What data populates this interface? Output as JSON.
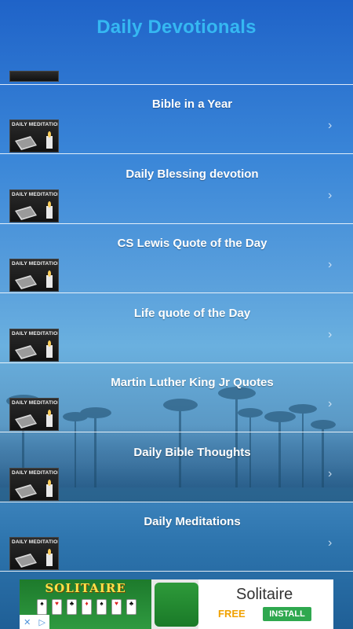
{
  "header": {
    "title": "Daily Devotionals"
  },
  "thumbnail_caption": "DAILY MEDITATION",
  "list": {
    "items": [
      {
        "label": "Bible in a Year"
      },
      {
        "label": "Daily Blessing devotion"
      },
      {
        "label": "CS Lewis Quote of the Day"
      },
      {
        "label": "Life quote of the Day"
      },
      {
        "label": "Martin Luther King Jr Quotes"
      },
      {
        "label": "Daily Bible Thoughts"
      },
      {
        "label": "Daily Meditations"
      }
    ]
  },
  "icons": {
    "thumb": "bible-candle-thumbnail-icon",
    "chevron": "chevron-right-icon"
  },
  "ad": {
    "banner_title": "SOLITAIRE",
    "app_name": "Solitaire",
    "price": "FREE",
    "install_label": "INSTALL",
    "choices_icon": "ad-choices-icon"
  },
  "colors": {
    "title": "#35b8f2",
    "row_text": "#ffffff",
    "divider": "#ffffff",
    "install_button": "#2fa84f",
    "free_text": "#f0a100"
  }
}
